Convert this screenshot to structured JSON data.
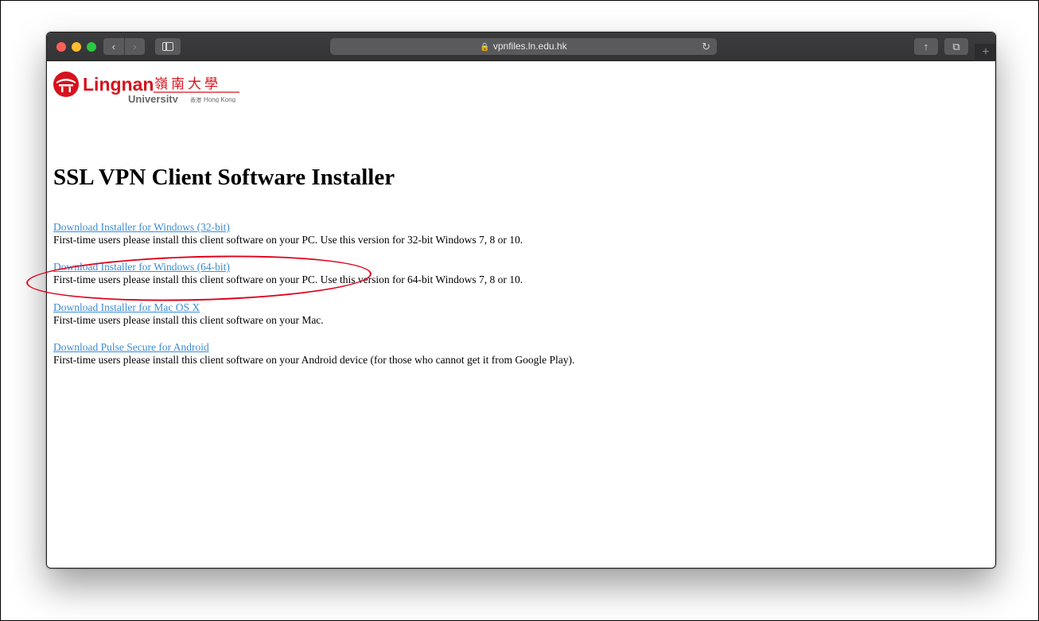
{
  "browser": {
    "url": "vpnfiles.ln.edu.hk",
    "icons": [
      "back-icon",
      "forward-icon",
      "sidebar-icon",
      "lock-icon",
      "reload-icon",
      "share-icon",
      "tabs-icon",
      "plus-icon"
    ],
    "new_tab_label": "+"
  },
  "logo": {
    "text_en": "Lingnan",
    "text_zh": "嶺南大學",
    "sub_en": "University",
    "sub_zh": "香港",
    "sub_city": "Hong Kong",
    "brand_color": "#d7121c"
  },
  "page": {
    "title": "SSL VPN Client Software Installer",
    "items": [
      {
        "link": "Download Installer for Windows (32-bit)",
        "desc": "First-time users please install this client software on your PC. Use this version for 32-bit Windows 7, 8 or 10."
      },
      {
        "link": "Download Installer for Windows (64-bit)",
        "desc": "First-time users please install this client software on your PC. Use this version for 64-bit Windows 7, 8 or 10."
      },
      {
        "link": "Download Installer for Mac OS X",
        "desc": "First-time users please install this client software on your Mac."
      },
      {
        "link": "Download Pulse Secure for Android",
        "desc": "First-time users please install this client software on your Android device (for those who cannot get it from Google Play)."
      }
    ]
  },
  "colors": {
    "link": "#3b8cd6",
    "annotation": "#e0001b"
  }
}
